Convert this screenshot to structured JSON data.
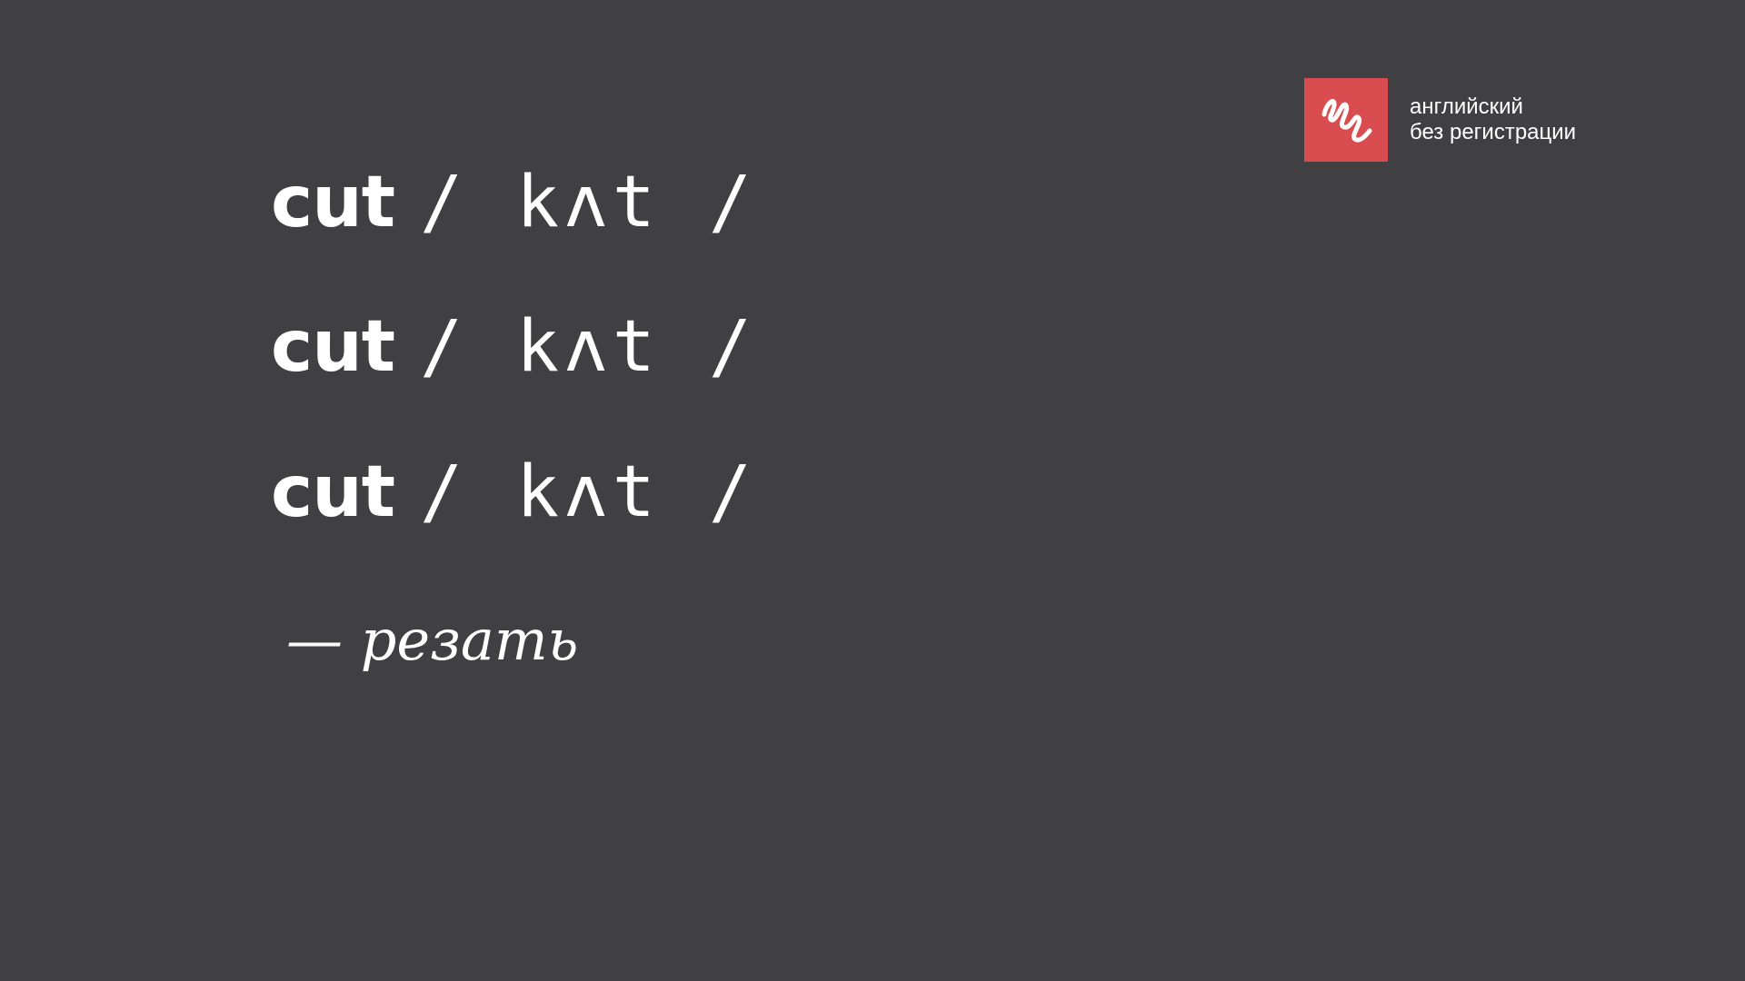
{
  "brand": {
    "line1": "английский",
    "line2": "без регистрации",
    "icon": "squiggle-logo-icon",
    "accent_color": "#d94c4f"
  },
  "background_color": "#404042",
  "entries": [
    {
      "word": "cut",
      "transcription": "/ kʌt /"
    },
    {
      "word": "cut",
      "transcription": "/ kʌt /"
    },
    {
      "word": "cut",
      "transcription": "/ kʌt /"
    }
  ],
  "translation": "— резать"
}
